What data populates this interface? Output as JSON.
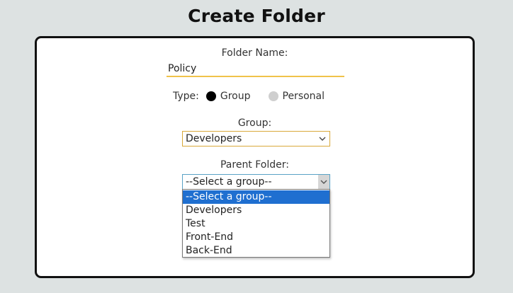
{
  "page": {
    "title": "Create Folder"
  },
  "form": {
    "folder_name_label": "Folder Name:",
    "folder_name_value": "Policy",
    "type_label": "Type:",
    "type_options": [
      {
        "label": "Group",
        "checked": true
      },
      {
        "label": "Personal",
        "checked": false
      }
    ],
    "group_label": "Group:",
    "group_selected": "Developers",
    "parent_label": "Parent Folder:",
    "parent_selected": "--Select a group--",
    "parent_options": [
      "--Select a group--",
      "Developers",
      "Test",
      "Front-End",
      "Back-End"
    ]
  },
  "colors": {
    "background": "#dde2e2",
    "input_underline": "#f0c34a",
    "selected_highlight": "#1f6fd0",
    "radio_checked": "#000000",
    "radio_unchecked": "#cfcfcf"
  },
  "icons": {
    "select_arrow": "chevron-down-icon"
  }
}
